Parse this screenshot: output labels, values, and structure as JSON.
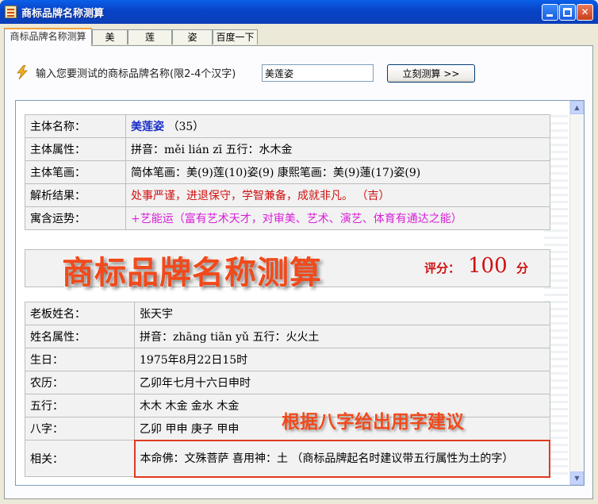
{
  "window": {
    "title": "商标品牌名称测算"
  },
  "tabs": [
    {
      "label": "商标品牌名称测算"
    },
    {
      "label": "美"
    },
    {
      "label": "莲"
    },
    {
      "label": "姿"
    },
    {
      "label": "百度一下"
    }
  ],
  "input_row": {
    "prompt": "输入您要测试的商标品牌名称(限2-4个汉字)",
    "value": "美莲姿",
    "button_label": "立刻测算 >>"
  },
  "brand_table": {
    "rows": [
      {
        "label": "主体名称：",
        "name": "美莲姿",
        "extra": "（35）"
      },
      {
        "label": "主体属性：",
        "value": "拼音：měi lián zī 五行：水木金"
      },
      {
        "label": "主体笔画：",
        "value": "简体笔画：美(9)莲(10)姿(9) 康熙笔画：美(9)蓮(17)姿(9)"
      },
      {
        "label": "解析结果：",
        "value": "处事严谨，进退保守，学智兼备，成就非凡。       （吉）"
      },
      {
        "label": "寓含运势：",
        "value": "+艺能运（富有艺术天才，对审美、艺术、演艺、体育有通达之能）"
      }
    ]
  },
  "banner": {
    "title": "商标品牌名称测算",
    "score_label": "评分：",
    "score_value": "100",
    "score_unit": "分"
  },
  "owner_table": {
    "rows": [
      {
        "label": "老板姓名：",
        "value": "张天宇"
      },
      {
        "label": "姓名属性：",
        "value": "拼音：zhāng tiān yǔ 五行：火火土"
      },
      {
        "label": "生日：",
        "value": "1975年8月22日15时"
      },
      {
        "label": "农历：",
        "value": "乙卯年七月十六日申时"
      },
      {
        "label": "五行：",
        "value": "木木 木金 金水 木金"
      },
      {
        "label": "八字：",
        "value": "乙卯 甲申 庚子 甲申"
      },
      {
        "label": "相关：",
        "value": "本命佛：文殊菩萨     喜用神：土  （商标品牌起名时建议带五行属性为土的字）"
      }
    ]
  },
  "overlay_hint": "根据八字给出用字建议",
  "colors": {
    "title_bar": "#0843C6",
    "accent_red": "#D01010",
    "name_blue": "#1A2FC8",
    "fortune_magenta": "#D81ED8",
    "banner_orange": "#F04A1C"
  },
  "icons": {
    "app": "document-icon",
    "prompt": "lightning-bolt-icon"
  }
}
